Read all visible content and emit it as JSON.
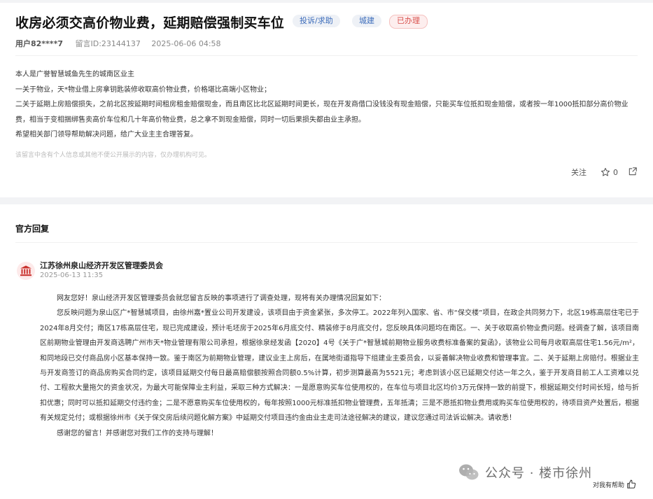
{
  "post": {
    "title": "收房必须交高价物业费，延期赔偿强制买车位",
    "tags": [
      "投诉/求助",
      "城建",
      "已办理"
    ],
    "user": "用户82****7",
    "message_id": "留言ID:23144137",
    "time": "2025-06-06 04:58",
    "body": [
      "本人是广誉智慧城鱼先生的城南区业主",
      "一关于物业，天*物业借上房拿钥匙装修收取高价物业费，价格堪比高端小区物业；",
      "二关于延期上房赔偿损失，之前北区按延期时间租房租金赔偿现金，而且南区比北区延期时间更长，现在开发商借口没钱没有现金赔偿，只能买车位抵扣现金赔偿，或者按一年1000抵扣部分高价物业费，相当于变相捆绑售卖高价车位和几十年高价物业费，总之拿不到现金赔偿，同时一切后果损失都由业主承担。",
      "希望相关部门领导帮助解决问题，给广大业主主合理答复。"
    ],
    "privacy_note": "该留言中含有个人信息或其他不便公开展示的内容，仅办理机构可见。",
    "actions": {
      "follow": "关注",
      "like_count": "0"
    }
  },
  "official": {
    "heading": "官方回复",
    "org": "江苏徐州泉山经济开发区管理委员会",
    "time": "2025-06-13 11:35",
    "paragraphs": [
      "网友您好！泉山经济开发区管理委员会就您留言反映的事项进行了调查处理，现将有关办理情况回复如下：",
      "您反映问题为泉山区广*智慧城项目，由徐州嘉*置业公司开发建设，该项目由于资金紧张，多次停工。2022年列入国家、省、市“保交楼”项目，在政企共同努力下，北区19栋高层住宅已于2024年8月交付；南区17栋高层住宅，现已完成建设，预计毛坯房于2025年6月底交付、精装修于8月底交付，您反映具体问题均在南区。一、关于收取高价物业费问题。经调查了解，该项目南区前期物业管理由开发商选聘广州市天*物业管理有限公司承担，根据徐泉经发函【2020】4号《关于广*智慧城前期物业服务收费标准备案的复函》，该物业公司每月收取高层住宅1.56元/m²，和同地段已交付商品房小区基本保持一致。鉴于南区为前期物业管理，建议业主上房后，在属地街道指导下组建业主委员会，以妥善解决物业收费和管理事宜。二、关于延期上房赔付。根据业主与开发商签订的商品房购买合同约定，该项目延期交付每日最高赔偿额按照合同额0.5%计算，初步测算最高为5521元；考虑到该小区已延期交付达一年之久，鉴于开发商目前工人工资难以兑付、工程款大量拖欠的资金状况，为最大可能保障业主利益，采取三种方式解决：一是愿意购买车位使用权的，在车位与项目北区均价3万元保持一致的前提下，根据延期交付时间长短，给与折扣优惠；同时可以抵扣延期交付违约金；二是不愿意购买车位使用权的，每年按照1000元标准抵扣物业管理费，五年抵清；三是不愿抵扣物业费用或购买车位使用权的，待项目资产处置后，根据有关规定兑付；或根据徐州市《关于保交房后续问题化解方案》中延期交付项目违约金由业主走司法途径解决的建议，建议您通过司法诉讼解决。请收悉！",
      "感谢您的留言！并感谢您对我们工作的支持与理解！"
    ]
  },
  "watermark": "公众号 · 楼市徐州",
  "help_label": "对我有帮助",
  "colors": {
    "accent_blue": "#3d6dbb",
    "status_red": "#d9534f",
    "gov_icon": "#c9302c"
  }
}
